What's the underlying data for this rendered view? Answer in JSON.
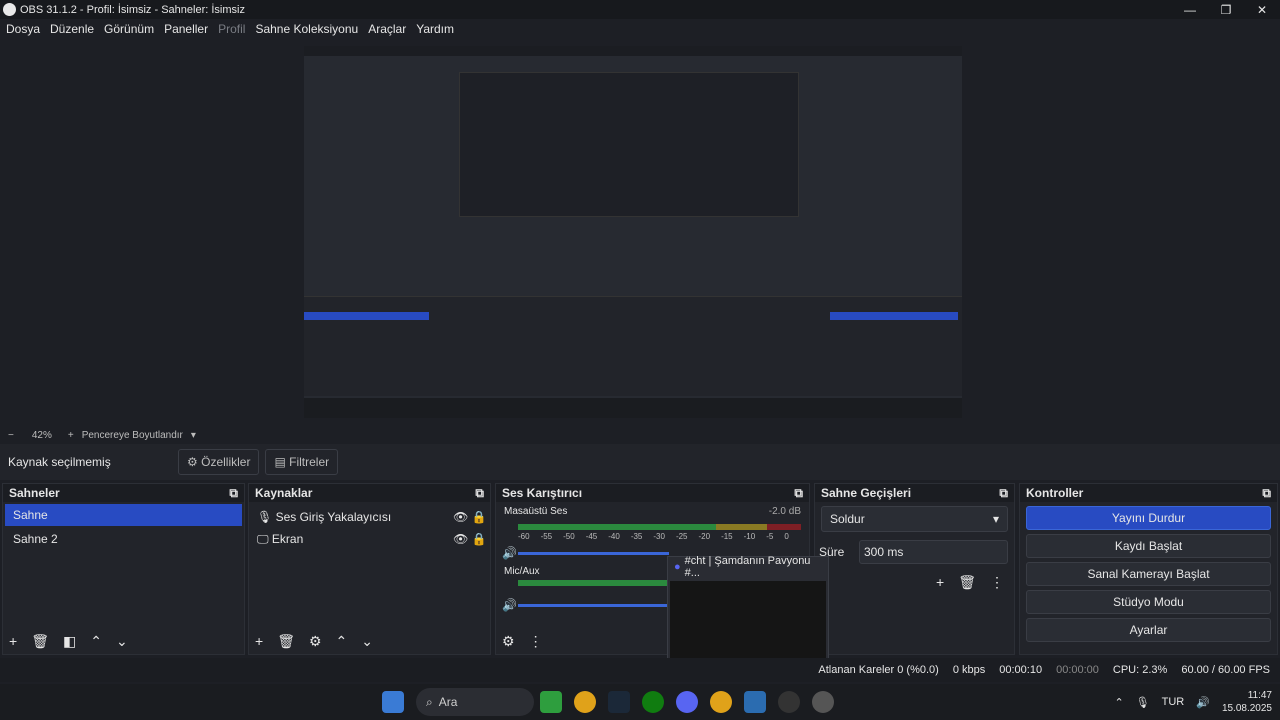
{
  "window": {
    "title": "OBS 31.1.2 - Profil: İsimsiz - Sahneler: İsimsiz",
    "controls": [
      "—",
      "❐",
      "✕"
    ]
  },
  "menu": [
    "Dosya",
    "Düzenle",
    "Görünüm",
    "Paneller",
    "Profil",
    "Sahne Koleksiyonu",
    "Araçlar",
    "Yardım"
  ],
  "zoom": {
    "minus": "−",
    "value": "42%",
    "plus": "+",
    "fit": "Pencereye Boyutlandır"
  },
  "toolbar": {
    "no_source": "Kaynak seçilmemiş",
    "properties": "Özellikler",
    "filters": "Filtreler"
  },
  "scenes": {
    "title": "Sahneler",
    "items": [
      "Sahne",
      "Sahne 2"
    ]
  },
  "sources": {
    "title": "Kaynaklar",
    "items": [
      "Ses Giriş Yakalayıcısı",
      "Ekran"
    ]
  },
  "mixer": {
    "title": "Ses Karıştırıcı",
    "channels": [
      {
        "name": "Masaüstü Ses",
        "db": "-2.0 dB"
      },
      {
        "name": "Mic/Aux",
        "db": ""
      }
    ],
    "ticks": [
      "-60",
      "-55",
      "-50",
      "-45",
      "-40",
      "-35",
      "-30",
      "-25",
      "-20",
      "-15",
      "-10",
      "-5",
      "0"
    ]
  },
  "transitions": {
    "title": "Sahne Geçişleri",
    "type": "Soldur",
    "duration_label": "Süre",
    "duration": "300 ms"
  },
  "controls": {
    "title": "Kontroller",
    "stop_stream": "Yayını Durdur",
    "start_record": "Kaydı Başlat",
    "virtual_cam": "Sanal Kamerayı Başlat",
    "studio": "Stüdyo Modu",
    "settings": "Ayarlar"
  },
  "popup": {
    "title": "#cht | Şamdanın Pavyonu #..."
  },
  "status": {
    "dropped": "Atlanan Kareler 0 (%0.0)",
    "kbps": "0 kbps",
    "stream_time": "00:00:10",
    "rec_time": "00:00:00",
    "cpu": "CPU: 2.3%",
    "fps": "60.00 / 60.00 FPS"
  },
  "taskbar": {
    "search": "Ara",
    "lang": "TUR",
    "time": "11:47",
    "date": "15.08.2025"
  },
  "colors": {
    "accent": "#284bc2"
  }
}
